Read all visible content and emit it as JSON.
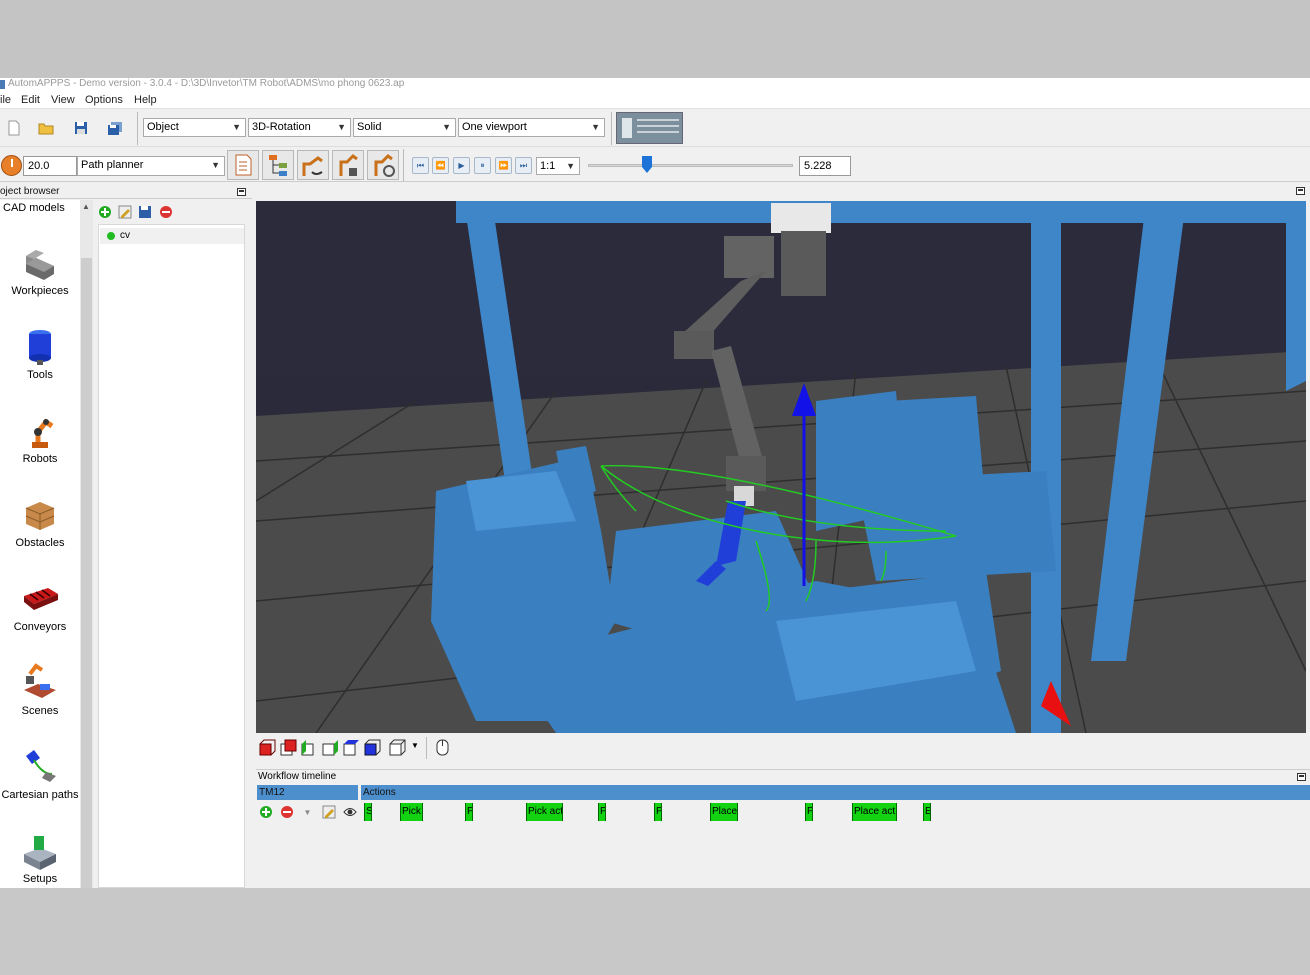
{
  "window": {
    "title": "AutomAPPPS - Demo version - 3.0.4 - D:\\3D\\Invetor\\TM Robot\\ADMS\\mo phong 0623.ap"
  },
  "menu": {
    "items": [
      {
        "label": "ile"
      },
      {
        "label": "Edit"
      },
      {
        "label": "View"
      },
      {
        "label": "Options"
      },
      {
        "label": "Help"
      }
    ]
  },
  "toolbar": {
    "mode_combo": "Object",
    "rotation_combo": "3D-Rotation",
    "render_combo": "Solid",
    "viewport_combo": "One viewport",
    "speed_value": "20.0",
    "planner_combo": "Path planner",
    "ratio_combo": "1:1",
    "slider_value": 0.29,
    "time_value": "5.228"
  },
  "browser": {
    "header": "oject browser",
    "category_title": "CAD models",
    "categories": [
      {
        "label": "Workpieces",
        "icon": "workpiece-icon"
      },
      {
        "label": "Tools",
        "icon": "tool-icon"
      },
      {
        "label": "Robots",
        "icon": "robot-icon"
      },
      {
        "label": "Obstacles",
        "icon": "obstacle-icon"
      },
      {
        "label": "Conveyors",
        "icon": "conveyor-icon"
      },
      {
        "label": "Scenes",
        "icon": "scene-icon"
      },
      {
        "label": "Cartesian paths",
        "icon": "cartesian-path-icon"
      },
      {
        "label": "Setups",
        "icon": "setup-icon"
      }
    ],
    "items": [
      {
        "label": "cv",
        "status_color": "#22bb22"
      }
    ]
  },
  "timeline": {
    "header": "Workflow timeline",
    "robot": "TM12",
    "actions_label": "Actions",
    "blocks": [
      {
        "label": "S"
      },
      {
        "label": "Pick"
      },
      {
        "label": "P"
      },
      {
        "label": "Pick act"
      },
      {
        "label": "P"
      },
      {
        "label": "P"
      },
      {
        "label": "Place"
      },
      {
        "label": "P"
      },
      {
        "label": "Place act"
      },
      {
        "label": "E"
      }
    ]
  },
  "colors": {
    "scene_blue": "#3f86c8",
    "robot_gray": "#5a5a5a",
    "path_green": "#22cc22",
    "timeline_blue": "#4d8fcc",
    "block_green": "#12d212"
  }
}
